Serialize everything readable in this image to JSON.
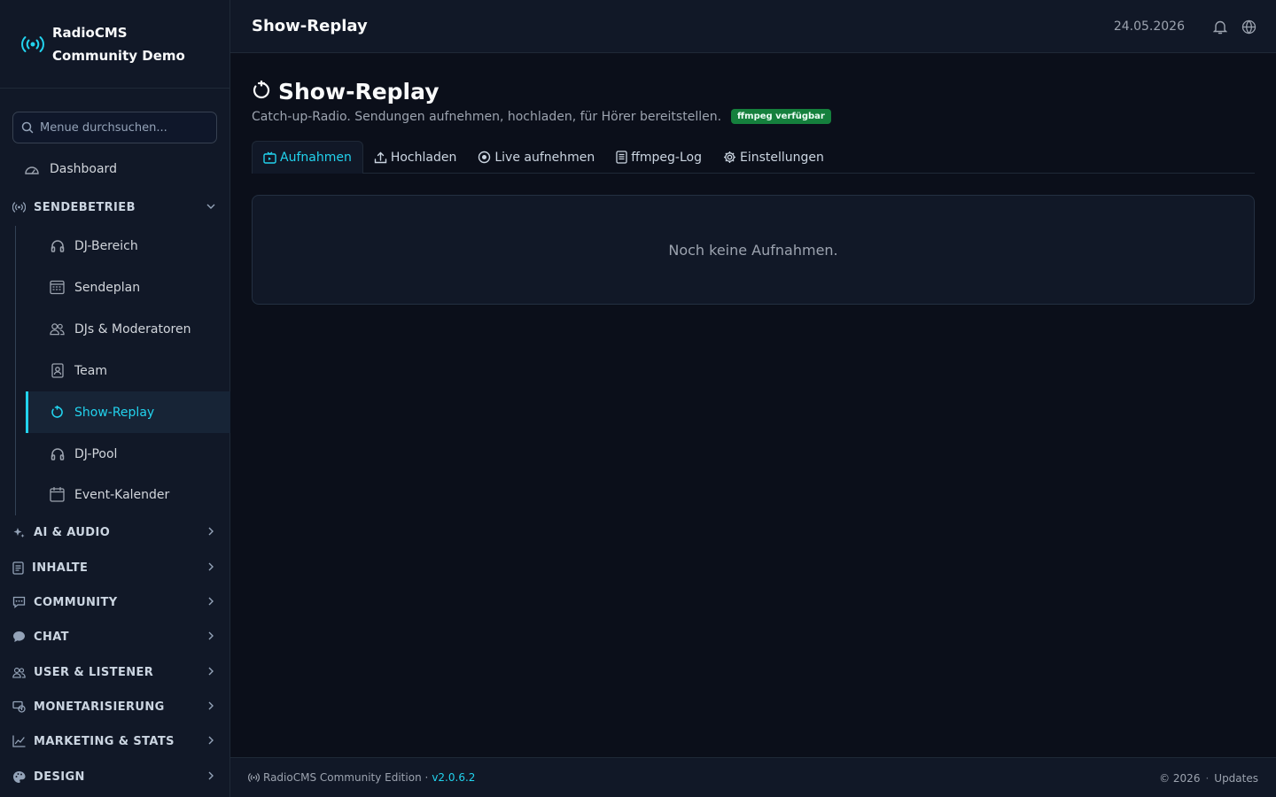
{
  "brand": {
    "line1": "RadioCMS",
    "line2": "Community Demo"
  },
  "search": {
    "placeholder": "Menue durchsuchen..."
  },
  "nav": {
    "dashboard": "Dashboard",
    "sections": {
      "sendebetrieb": "SENDEBETRIEB",
      "ai_audio": "AI & AUDIO",
      "inhalte": "INHALTE",
      "community": "COMMUNITY",
      "chat": "CHAT",
      "user_listener": "USER & LISTENER",
      "monetarisierung": "MONETARISIERUNG",
      "marketing": "MARKETING & STATS",
      "design": "DESIGN"
    },
    "sub": {
      "dj_bereich": "DJ-Bereich",
      "sendeplan": "Sendeplan",
      "djs": "DJs & Moderatoren",
      "team": "Team",
      "show_replay": "Show-Replay",
      "dj_pool": "DJ-Pool",
      "event_kalender": "Event-Kalender"
    }
  },
  "topbar": {
    "title": "Show-Replay",
    "date": "24.05.2026"
  },
  "page": {
    "title": "Show-Replay",
    "subtitle": "Catch-up-Radio. Sendungen aufnehmen, hochladen, für Hörer bereitstellen.",
    "badge": "ffmpeg verfügbar",
    "tabs": {
      "aufnahmen": "Aufnahmen",
      "hochladen": "Hochladen",
      "live": "Live aufnehmen",
      "log": "ffmpeg-Log",
      "einstellungen": "Einstellungen"
    },
    "empty": "Noch keine Aufnahmen."
  },
  "footer": {
    "edition": "RadioCMS Community Edition ·",
    "version": "v2.0.6.2",
    "copyright": "© 2026",
    "updates": "Updates"
  },
  "colors": {
    "accent": "#22d3ee",
    "badge": "#15803d",
    "background": "#0b0f1a",
    "panel": "#111827"
  }
}
